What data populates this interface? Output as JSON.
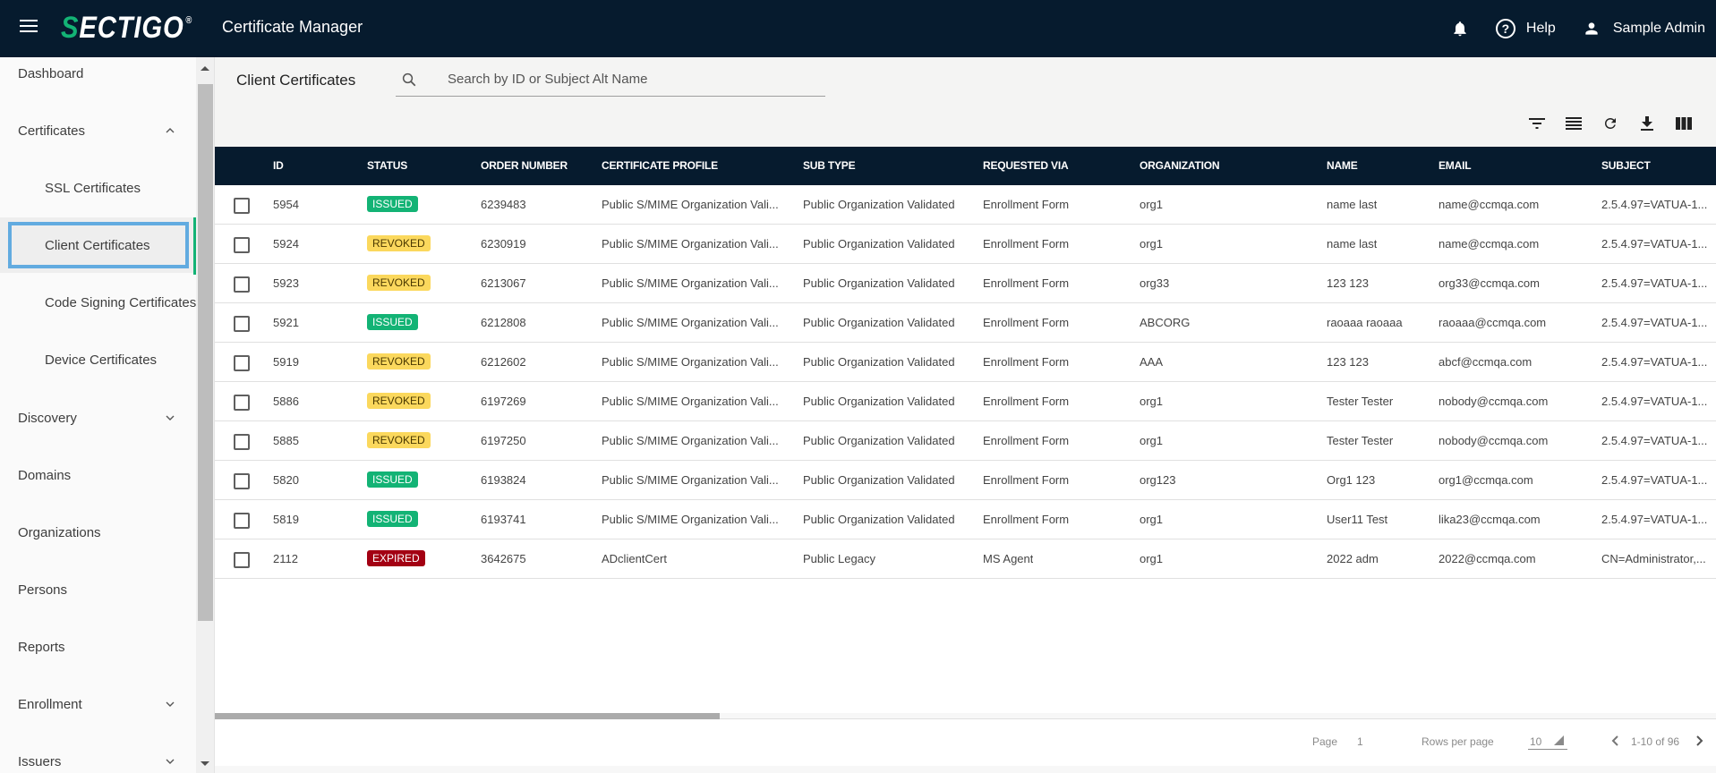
{
  "header": {
    "logo_first": "S",
    "logo_rest": "ECTIGO",
    "logo_mark": "®",
    "app_title": "Certificate Manager",
    "help_label": "Help",
    "user_name": "Sample Admin",
    "colors": {
      "background": "#061b2e",
      "brand_green": "#13b375"
    }
  },
  "sidebar": {
    "items": [
      {
        "label": "Dashboard",
        "chevron": null
      },
      {
        "label": "Certificates",
        "chevron": "up"
      },
      {
        "label": "SSL Certificates",
        "sub": true
      },
      {
        "label": "Client Certificates",
        "sub": true,
        "selected": true
      },
      {
        "label": "Code Signing Certificates",
        "sub": true
      },
      {
        "label": "Device Certificates",
        "sub": true
      },
      {
        "label": "Discovery",
        "chevron": "down"
      },
      {
        "label": "Domains"
      },
      {
        "label": "Organizations"
      },
      {
        "label": "Persons"
      },
      {
        "label": "Reports"
      },
      {
        "label": "Enrollment",
        "chevron": "down"
      },
      {
        "label": "Issuers",
        "chevron": "down"
      }
    ]
  },
  "main": {
    "page_title": "Client Certificates",
    "search": {
      "placeholder": "Search by ID or Subject Alt Name",
      "value": ""
    },
    "toolbar": [
      "filter-icon",
      "density-icon",
      "refresh-icon",
      "download-icon",
      "columns-icon"
    ]
  },
  "table": {
    "columns": [
      "ID",
      "STATUS",
      "ORDER NUMBER",
      "CERTIFICATE PROFILE",
      "SUB TYPE",
      "REQUESTED VIA",
      "ORGANIZATION",
      "NAME",
      "EMAIL",
      "SUBJECT"
    ],
    "rows": [
      {
        "id": "5954",
        "status": "ISSUED",
        "order": "6239483",
        "profile": "Public S/MIME Organization Vali...",
        "subtype": "Public Organization Validated",
        "via": "Enrollment Form",
        "org": "org1",
        "name": "name last",
        "email": "name@ccmqa.com",
        "subject": "2.5.4.97=VATUA-1..."
      },
      {
        "id": "5924",
        "status": "REVOKED",
        "order": "6230919",
        "profile": "Public S/MIME Organization Vali...",
        "subtype": "Public Organization Validated",
        "via": "Enrollment Form",
        "org": "org1",
        "name": "name last",
        "email": "name@ccmqa.com",
        "subject": "2.5.4.97=VATUA-1..."
      },
      {
        "id": "5923",
        "status": "REVOKED",
        "order": "6213067",
        "profile": "Public S/MIME Organization Vali...",
        "subtype": "Public Organization Validated",
        "via": "Enrollment Form",
        "org": "org33",
        "name": "123 123",
        "email": "org33@ccmqa.com",
        "subject": "2.5.4.97=VATUA-1..."
      },
      {
        "id": "5921",
        "status": "ISSUED",
        "order": "6212808",
        "profile": "Public S/MIME Organization Vali...",
        "subtype": "Public Organization Validated",
        "via": "Enrollment Form",
        "org": "ABCORG",
        "name": "raoaaa raoaaa",
        "email": "raoaaa@ccmqa.com",
        "subject": "2.5.4.97=VATUA-1..."
      },
      {
        "id": "5919",
        "status": "REVOKED",
        "order": "6212602",
        "profile": "Public S/MIME Organization Vali...",
        "subtype": "Public Organization Validated",
        "via": "Enrollment Form",
        "org": "AAA",
        "name": "123 123",
        "email": "abcf@ccmqa.com",
        "subject": "2.5.4.97=VATUA-1..."
      },
      {
        "id": "5886",
        "status": "REVOKED",
        "order": "6197269",
        "profile": "Public S/MIME Organization Vali...",
        "subtype": "Public Organization Validated",
        "via": "Enrollment Form",
        "org": "org1",
        "name": "Tester Tester",
        "email": "nobody@ccmqa.com",
        "subject": "2.5.4.97=VATUA-1..."
      },
      {
        "id": "5885",
        "status": "REVOKED",
        "order": "6197250",
        "profile": "Public S/MIME Organization Vali...",
        "subtype": "Public Organization Validated",
        "via": "Enrollment Form",
        "org": "org1",
        "name": "Tester Tester",
        "email": "nobody@ccmqa.com",
        "subject": "2.5.4.97=VATUA-1..."
      },
      {
        "id": "5820",
        "status": "ISSUED",
        "order": "6193824",
        "profile": "Public S/MIME Organization Vali...",
        "subtype": "Public Organization Validated",
        "via": "Enrollment Form",
        "org": "org123",
        "name": "Org1 123",
        "email": "org1@ccmqa.com",
        "subject": "2.5.4.97=VATUA-1..."
      },
      {
        "id": "5819",
        "status": "ISSUED",
        "order": "6193741",
        "profile": "Public S/MIME Organization Vali...",
        "subtype": "Public Organization Validated",
        "via": "Enrollment Form",
        "org": "org1",
        "name": "User11 Test",
        "email": "lika23@ccmqa.com",
        "subject": "2.5.4.97=VATUA-1..."
      },
      {
        "id": "2112",
        "status": "EXPIRED",
        "order": "3642675",
        "profile": "ADclientCert",
        "subtype": "Public Legacy",
        "via": "MS Agent",
        "org": "org1",
        "name": "2022 adm",
        "email": "2022@ccmqa.com",
        "subject": "CN=Administrator,..."
      }
    ],
    "status_colors": {
      "ISSUED": "#13b375",
      "REVOKED": "#fbd85d",
      "EXPIRED": "#a30013"
    }
  },
  "pagination": {
    "page_label": "Page",
    "page_value": "1",
    "rows_per_page_label": "Rows per page",
    "rows_per_page_value": "10",
    "range_text": "1-10 of 96"
  }
}
